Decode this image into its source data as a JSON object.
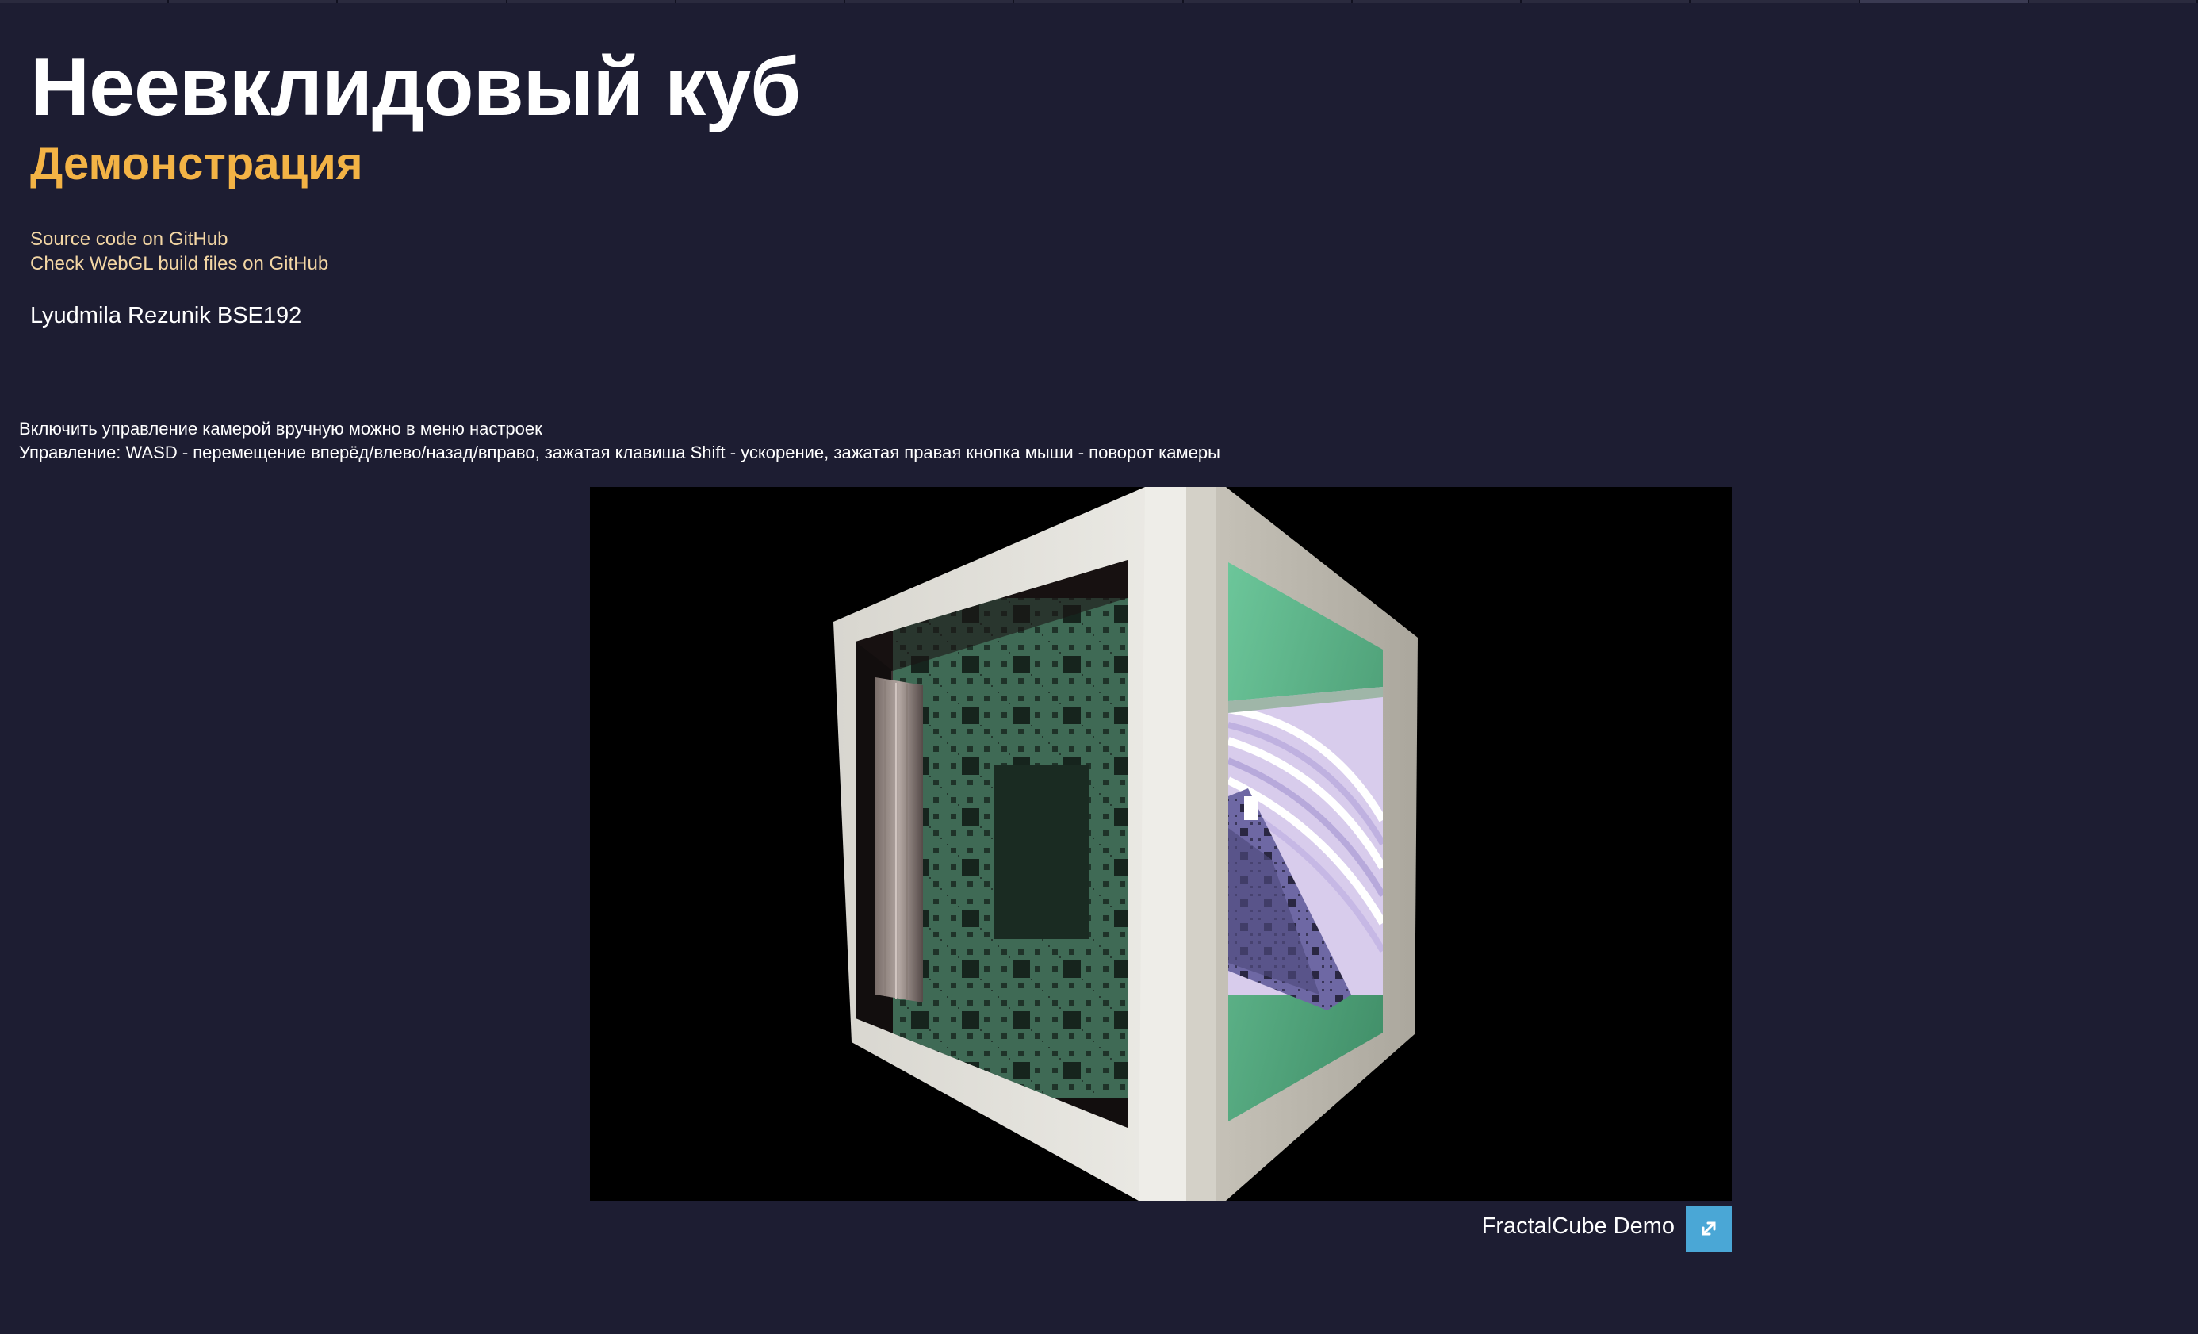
{
  "page": {
    "title": "Неевклидовый куб",
    "subtitle": "Демонстрация"
  },
  "links": [
    {
      "label": "Source code on GitHub"
    },
    {
      "label": "Check WebGL build files on GitHub"
    }
  ],
  "author": "Lyudmila Rezunik BSE192",
  "instructions": [
    "Включить управление камерой вручную можно в меню настроек",
    "Управление: WASD - перемещение вперёд/влево/назад/вправо, зажатая клавиша Shift - ускорение, зажатая правая кнопка мыши - поворот камеры"
  ],
  "player": {
    "name": "FractalCube Demo",
    "fullscreen_icon": "expand-arrows-icon"
  },
  "colors": {
    "background": "#1d1d32",
    "title": "#ffffff",
    "subtitle": "#f3b345",
    "link": "#f3d6a4",
    "fullscreen_button": "#4aa7d6",
    "canvas": "#000000"
  }
}
